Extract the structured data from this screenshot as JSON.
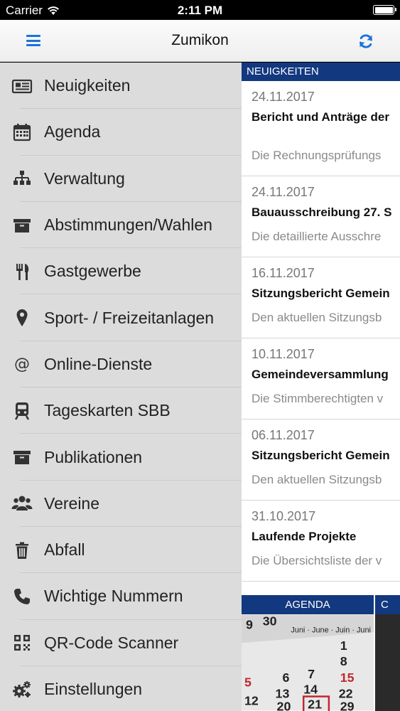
{
  "status_bar": {
    "carrier": "Carrier",
    "time": "2:11 PM"
  },
  "nav": {
    "title": "Zumikon",
    "menu_icon": "hamburger-icon",
    "refresh_icon": "refresh-icon",
    "accent": "#1a73d9"
  },
  "sidebar": {
    "items": [
      {
        "label": "Neuigkeiten",
        "icon": "newspaper-icon"
      },
      {
        "label": "Agenda",
        "icon": "calendar-icon"
      },
      {
        "label": "Verwaltung",
        "icon": "sitemap-icon"
      },
      {
        "label": "Abstimmungen/Wahlen",
        "icon": "archive-box-icon"
      },
      {
        "label": "Gastgewerbe",
        "icon": "cutlery-icon"
      },
      {
        "label": "Sport- / Freizeitanlagen",
        "icon": "map-marker-icon"
      },
      {
        "label": "Online-Dienste",
        "icon": "at-icon"
      },
      {
        "label": "Tageskarten SBB",
        "icon": "train-icon"
      },
      {
        "label": "Publikationen",
        "icon": "archive-box-icon"
      },
      {
        "label": "Vereine",
        "icon": "users-icon"
      },
      {
        "label": "Abfall",
        "icon": "trash-icon"
      },
      {
        "label": "Wichtige Nummern",
        "icon": "phone-icon"
      },
      {
        "label": "QR-Code Scanner",
        "icon": "qrcode-icon"
      },
      {
        "label": "Einstellungen",
        "icon": "gears-icon"
      }
    ]
  },
  "content": {
    "section_header": "NEUIGKEITEN",
    "header_color": "#12387f",
    "news": [
      {
        "date": "24.11.2017",
        "title": "Bericht und Anträge der",
        "desc": "Die Rechnungsprüfungs"
      },
      {
        "date": "24.11.2017",
        "title": "Bauausschreibung 27. S",
        "desc": "Die detaillierte Ausschre"
      },
      {
        "date": "16.11.2017",
        "title": "Sitzungsbericht Gemein",
        "desc": "Den aktuellen Sitzungsb"
      },
      {
        "date": "10.11.2017",
        "title": "Gemeindeversammlung",
        "desc": "Die Stimmberechtigten v"
      },
      {
        "date": "06.11.2017",
        "title": "Sitzungsbericht Gemein",
        "desc": "Den aktuellen Sitzungsb"
      },
      {
        "date": "31.10.2017",
        "title": "Laufende Projekte",
        "desc": "Die Übersichtsliste der v"
      }
    ],
    "tabs": {
      "agenda": "AGENDA",
      "next": "C"
    }
  }
}
